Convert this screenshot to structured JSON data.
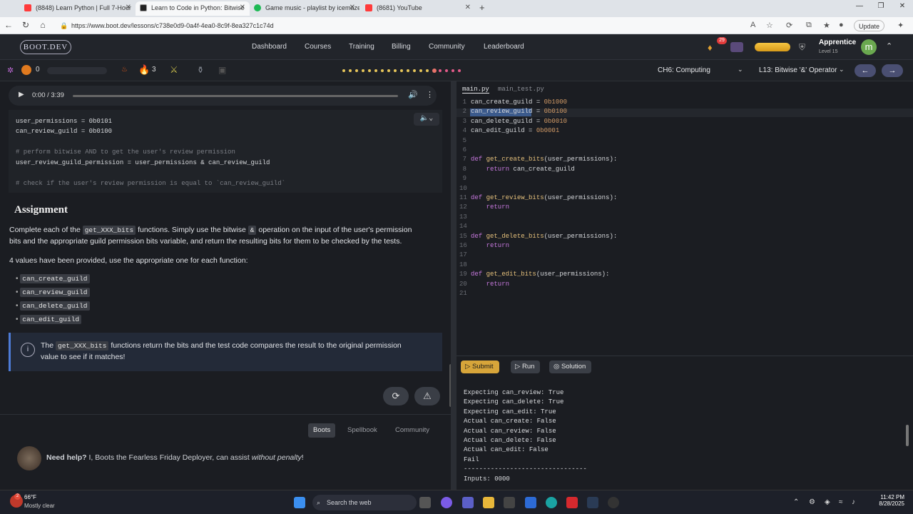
{
  "browser": {
    "tabs": [
      {
        "label": "(8848) Learn Python | Full 7-Hour",
        "color": "#ff3b3b"
      },
      {
        "label": "Learn to Code in Python: Bitwise",
        "color": "#222"
      },
      {
        "label": "Game music - playlist by icemaze",
        "color": "#1db954"
      },
      {
        "label": "(8681) YouTube",
        "color": "#ff3b3b"
      }
    ],
    "new_tab": "+",
    "url": "https://www.boot.dev/lessons/c738e0d9-0a4f-4ea0-8c9f-8ea327c1c74d",
    "update_label": "Update"
  },
  "site": {
    "logo": "BOOT.DEV",
    "nav": [
      "Dashboard",
      "Courses",
      "Training",
      "Billing",
      "Community",
      "Leaderboard"
    ],
    "gem_count": "29",
    "rank": "Apprentice",
    "level": "Level 15",
    "avatar_letter": "m"
  },
  "lessonbar": {
    "streak": "0",
    "flames": "3",
    "chapter": "CH6: Computing",
    "lesson": "L13: Bitwise '&' Operator",
    "prev": "←",
    "next": "→"
  },
  "audio": {
    "time": "0:00 / 3:39"
  },
  "example": {
    "lines": [
      {
        "t": "user_permissions = 0b0101",
        "c": false
      },
      {
        "t": "can_review_guild = 0b0100",
        "c": false
      },
      {
        "t": "",
        "c": false
      },
      {
        "t": "# perform bitwise AND to get the user's review permission",
        "c": true
      },
      {
        "t": "user_review_guild_permission = user_permissions & can_review_guild",
        "c": false
      },
      {
        "t": "",
        "c": false
      },
      {
        "t": "# check if the user's review permission is equal to `can_review_guild`",
        "c": true
      }
    ]
  },
  "assignment": {
    "heading": "Assignment",
    "p1a": "Complete each of the ",
    "p1code": "get_XXX_bits",
    "p1b": " functions. Simply use the bitwise ",
    "p1amp": "&",
    "p1c": " operation on the input of the user's permission",
    "p1d": "bits and the appropriate guild permission bits variable, and return the resulting bits for them to be checked by the tests.",
    "p2": "4 values have been provided, use the appropriate one for each function:",
    "bullets": [
      "can_create_guild",
      "can_review_guild",
      "can_delete_guild",
      "can_edit_guild"
    ],
    "callout_a": "The ",
    "callout_code": "get_XXX_bits",
    "callout_b": " functions return the bits and the test code compares the result to the original permission",
    "callout_c": "value to see if it matches!"
  },
  "help": {
    "tabs": [
      "Boots",
      "Spellbook",
      "Community"
    ],
    "need_help": "Need help?",
    "text": " I, Boots the Fearless Friday Deployer, can assist ",
    "italic": "without penalty",
    "end": "!"
  },
  "editor": {
    "tabs": [
      "main.py",
      "main_test.py"
    ],
    "lines": [
      "can_create_guild = 0b1000",
      "can_review_guild = 0b0100",
      "can_delete_guild = 0b0010",
      "can_edit_guild = 0b0001",
      "",
      "",
      "def get_create_bits(user_permissions):",
      "    return can_create_guild",
      "",
      "",
      "def get_review_bits(user_permissions):",
      "    return",
      "",
      "",
      "def get_delete_bits(user_permissions):",
      "    return",
      "",
      "",
      "def get_edit_bits(user_permissions):",
      "    return",
      ""
    ]
  },
  "console": {
    "submit": "Submit",
    "run": "Run",
    "solution": "Solution",
    "output": [
      "Expecting can_review: True",
      "Expecting can_delete: True",
      "Expecting can_edit: True",
      "Actual can_create: False",
      "Actual can_review: False",
      "Actual can_delete: False",
      "Actual can_edit: False",
      "Fail",
      "--------------------------------",
      "Inputs: 0000"
    ]
  },
  "taskbar": {
    "temp": "66°F",
    "weather": "Mostly clear",
    "search": "Search the web",
    "time": "11:42 PM",
    "date": "8/28/2025",
    "notif": "2"
  }
}
